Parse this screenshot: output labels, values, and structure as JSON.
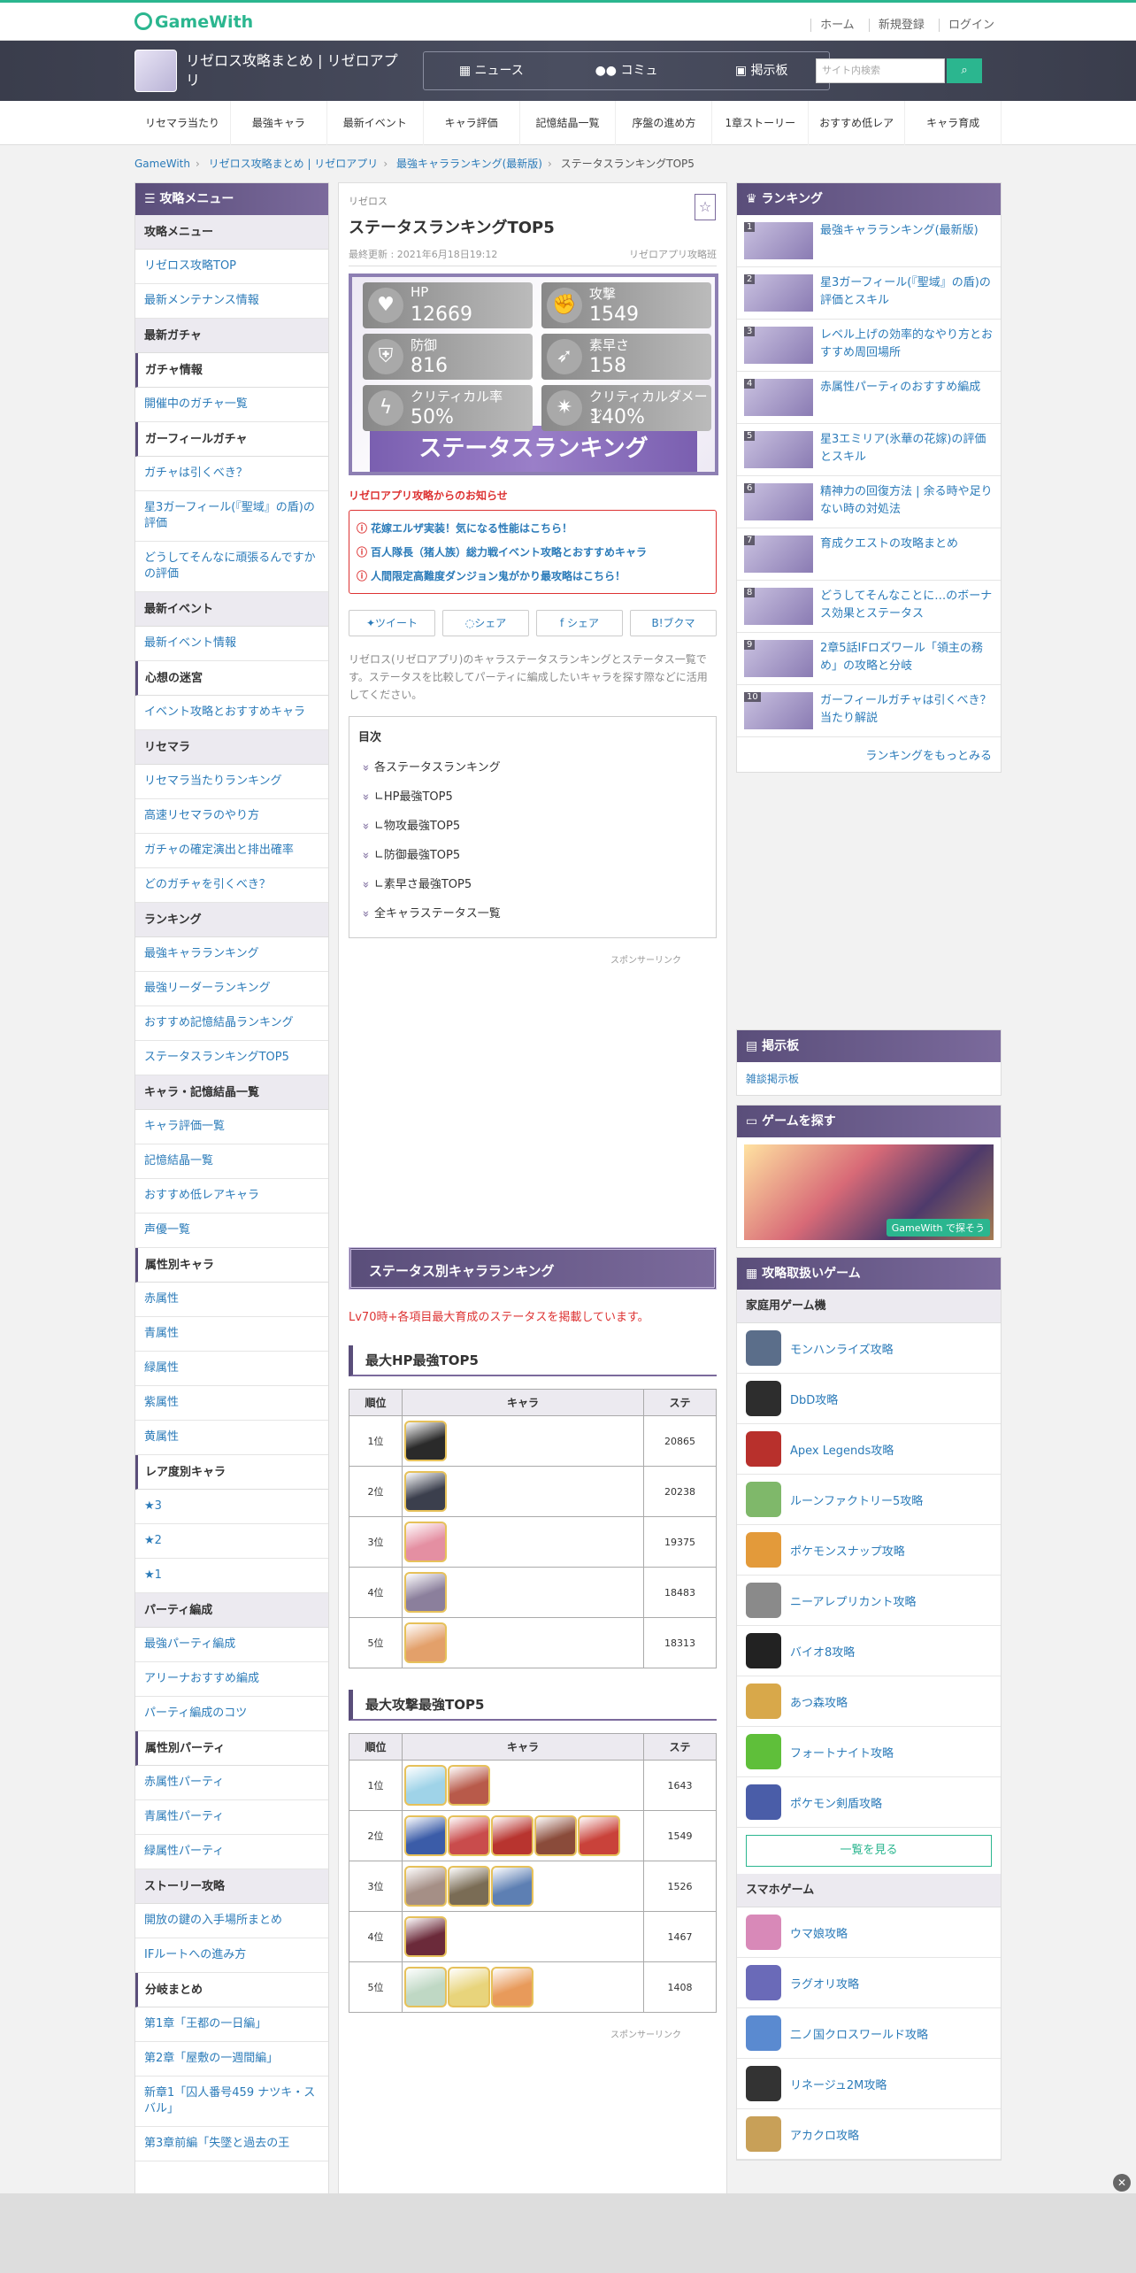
{
  "header": {
    "logo": "GameWith",
    "links": [
      "ホーム",
      "新規登録",
      "ログイン"
    ]
  },
  "gamebar": {
    "title": "リゼロス攻略まとめ | リゼロアプリ",
    "nav": [
      "ニュース",
      "コミュ",
      "掲示板"
    ],
    "search_placeholder": "サイト内検索"
  },
  "subnav": [
    "リセマラ当たり",
    "最強キャラ",
    "最新イベント",
    "キャラ評価",
    "記憶結晶一覧",
    "序盤の進め方",
    "1章ストーリー",
    "おすすめ低レア",
    "キャラ育成"
  ],
  "breadcrumb": [
    "GameWith",
    "リゼロス攻略まとめ | リゼロアプリ",
    "最強キャラランキング(最新版)",
    "ステータスランキングTOP5"
  ],
  "left_menu": {
    "title": "攻略メニュー",
    "entries": [
      {
        "t": "sec",
        "label": "攻略メニュー"
      },
      {
        "t": "item",
        "label": "リゼロス攻略TOP"
      },
      {
        "t": "item",
        "label": "最新メンテナンス情報"
      },
      {
        "t": "sec",
        "label": "最新ガチャ"
      },
      {
        "t": "sub",
        "label": "ガチャ情報"
      },
      {
        "t": "item",
        "label": "開催中のガチャ一覧"
      },
      {
        "t": "sub",
        "label": "ガーフィールガチャ"
      },
      {
        "t": "item",
        "label": "ガチャは引くべき？"
      },
      {
        "t": "item",
        "label": "星3ガーフィール(『聖域』の盾)の評価"
      },
      {
        "t": "item",
        "label": "どうしてそんなに頑張るんですかの評価"
      },
      {
        "t": "sec",
        "label": "最新イベント"
      },
      {
        "t": "item",
        "label": "最新イベント情報"
      },
      {
        "t": "sub",
        "label": "心想の迷宮"
      },
      {
        "t": "item",
        "label": "イベント攻略とおすすめキャラ"
      },
      {
        "t": "sec",
        "label": "リセマラ"
      },
      {
        "t": "item",
        "label": "リセマラ当たりランキング"
      },
      {
        "t": "item",
        "label": "高速リセマラのやり方"
      },
      {
        "t": "item",
        "label": "ガチャの確定演出と排出確率"
      },
      {
        "t": "item",
        "label": "どのガチャを引くべき？"
      },
      {
        "t": "sec",
        "label": "ランキング"
      },
      {
        "t": "item",
        "label": "最強キャラランキング"
      },
      {
        "t": "item",
        "label": "最強リーダーランキング"
      },
      {
        "t": "item",
        "label": "おすすめ記憶結晶ランキング"
      },
      {
        "t": "item",
        "label": "ステータスランキングTOP5"
      },
      {
        "t": "sec",
        "label": "キャラ・記憶結晶一覧"
      },
      {
        "t": "item",
        "label": "キャラ評価一覧"
      },
      {
        "t": "item",
        "label": "記憶結晶一覧"
      },
      {
        "t": "item",
        "label": "おすすめ低レアキャラ"
      },
      {
        "t": "item",
        "label": "声優一覧"
      },
      {
        "t": "sub",
        "label": "属性別キャラ"
      },
      {
        "t": "item",
        "label": "赤属性"
      },
      {
        "t": "item",
        "label": "青属性"
      },
      {
        "t": "item",
        "label": "緑属性"
      },
      {
        "t": "item",
        "label": "紫属性"
      },
      {
        "t": "item",
        "label": "黄属性"
      },
      {
        "t": "sub",
        "label": "レア度別キャラ"
      },
      {
        "t": "item",
        "label": "★3"
      },
      {
        "t": "item",
        "label": "★2"
      },
      {
        "t": "item",
        "label": "★1"
      },
      {
        "t": "sec",
        "label": "パーティ編成"
      },
      {
        "t": "item",
        "label": "最強パーティ編成"
      },
      {
        "t": "item",
        "label": "アリーナおすすめ編成"
      },
      {
        "t": "item",
        "label": "パーティ編成のコツ"
      },
      {
        "t": "sub",
        "label": "属性別パーティ"
      },
      {
        "t": "item",
        "label": "赤属性パーティ"
      },
      {
        "t": "item",
        "label": "青属性パーティ"
      },
      {
        "t": "item",
        "label": "緑属性パーティ"
      },
      {
        "t": "sec",
        "label": "ストーリー攻略"
      },
      {
        "t": "item",
        "label": "開放の鍵の入手場所まとめ"
      },
      {
        "t": "item",
        "label": "IFルートへの進み方"
      },
      {
        "t": "sub",
        "label": "分岐まとめ"
      },
      {
        "t": "item",
        "label": "第1章「王都の一日編」"
      },
      {
        "t": "item",
        "label": "第2章「屋敷の一週間編」"
      },
      {
        "t": "item",
        "label": "新章1「囚人番号459 ナツキ・スバル」"
      },
      {
        "t": "item",
        "label": "第3章前編「失墜と過去の王"
      }
    ]
  },
  "article": {
    "game_label": "リゼロス",
    "title": "ステータスランキングTOP5",
    "updated": "最終更新 : 2021年6月18日19:12",
    "author": "リゼロアプリ攻略班",
    "banner": {
      "stats": [
        {
          "name": "HP",
          "value": "12669",
          "icon": "♥"
        },
        {
          "name": "攻撃",
          "value": "1549",
          "icon": "✊"
        },
        {
          "name": "防御",
          "value": "816",
          "icon": "⛨"
        },
        {
          "name": "素早さ",
          "value": "158",
          "icon": "➶"
        },
        {
          "name": "クリティカル率",
          "value": "50%",
          "icon": "ϟ"
        },
        {
          "name": "クリティカルダメージ",
          "value": "140%",
          "icon": "✷"
        }
      ],
      "band": "ステータスランキング"
    },
    "notice_label": "リゼロアプリ攻略からのお知らせ",
    "notices": [
      "花嫁エルザ実装！気になる性能はこちら！",
      "百人隊長（猪人族）総力戦イベント攻略とおすすめキャラ",
      "人間限定高難度ダンジョン鬼がかり最攻略はこちら！"
    ],
    "share": [
      "ツイート",
      "シェア",
      "シェア",
      "ブクマ"
    ],
    "intro": "リゼロス(リゼロアプリ)のキャラステータスランキングとステータス一覧です。ステータスを比較してパーティに編成したいキャラを探す際などに活用してください。",
    "toc_title": "目次",
    "toc": [
      "各ステータスランキング",
      "∟HP最強TOP5",
      "∟物攻最強TOP5",
      "∟防御最強TOP5",
      "∟素早さ最強TOP5",
      "全キャラステータス一覧"
    ],
    "sponsor": "スポンサーリンク",
    "section_title": "ステータス別キャラランキング",
    "red_note": "Lv70時+各項目最大育成のステータスを掲載しています。",
    "table_headers": [
      "順位",
      "キャラ",
      "ステ"
    ],
    "hp_title": "最大HP最強TOP5",
    "hp_rows": [
      {
        "rank": "1位",
        "value": "20865",
        "chars": [
          "#2a2a2a"
        ]
      },
      {
        "rank": "2位",
        "value": "20238",
        "chars": [
          "#3b3f4d"
        ]
      },
      {
        "rank": "3位",
        "value": "19375",
        "chars": [
          "#e48fa2"
        ]
      },
      {
        "rank": "4位",
        "value": "18483",
        "chars": [
          "#8b7f9c"
        ]
      },
      {
        "rank": "5位",
        "value": "18313",
        "chars": [
          "#e3a06a"
        ]
      }
    ],
    "atk_title": "最大攻撃最強TOP5",
    "atk_rows": [
      {
        "rank": "1位",
        "value": "1643",
        "chars": [
          "#9fd3e8",
          "#b85a4a"
        ]
      },
      {
        "rank": "2位",
        "value": "1549",
        "chars": [
          "#3b5ca8",
          "#c94c4c",
          "#b8342f",
          "#8a4b3a",
          "#c9423a"
        ]
      },
      {
        "rank": "3位",
        "value": "1526",
        "chars": [
          "#a58f86",
          "#7a6c55",
          "#5d7fb3"
        ]
      },
      {
        "rank": "4位",
        "value": "1467",
        "chars": [
          "#6b2a3a"
        ]
      },
      {
        "rank": "5位",
        "value": "1408",
        "chars": [
          "#bfd8c4",
          "#e8d47b",
          "#e89a5a"
        ]
      }
    ]
  },
  "right": {
    "ranking_title": "ランキング",
    "ranking": [
      {
        "n": "1",
        "label": "最強キャラランキング(最新版)"
      },
      {
        "n": "2",
        "label": "星3ガーフィール(『聖域』の盾)の評価とスキル"
      },
      {
        "n": "3",
        "label": "レベル上げの効率的なやり方とおすすめ周回場所"
      },
      {
        "n": "4",
        "label": "赤属性パーティのおすすめ編成"
      },
      {
        "n": "5",
        "label": "星3エミリア(氷華の花嫁)の評価とスキル"
      },
      {
        "n": "6",
        "label": "精神力の回復方法 | 余る時や足りない時の対処法"
      },
      {
        "n": "7",
        "label": "育成クエストの攻略まとめ"
      },
      {
        "n": "8",
        "label": "どうしてそんなことに…のボーナス効果とステータス"
      },
      {
        "n": "9",
        "label": "2章5話IFロズワール「領主の務め」の攻略と分岐"
      },
      {
        "n": "10",
        "label": "ガーフィールガチャは引くべき？当たり解説"
      }
    ],
    "ranking_more": "ランキングをもっとみる",
    "board_title": "掲示板",
    "board_link": "雑談掲示板",
    "find_title": "ゲームを探す",
    "find_badge": "GameWith で探そう",
    "games_title": "攻略取扱いゲーム",
    "console_title": "家庭用ゲーム機",
    "console": [
      {
        "name": "モンハンライズ攻略",
        "color": "#5b6e8a"
      },
      {
        "name": "DbD攻略",
        "color": "#2d2d2d"
      },
      {
        "name": "Apex Legends攻略",
        "color": "#b8302c"
      },
      {
        "name": "ルーンファクトリー5攻略",
        "color": "#7fb86a"
      },
      {
        "name": "ポケモンスナップ攻略",
        "color": "#e39a3a"
      },
      {
        "name": "ニーアレプリカント攻略",
        "color": "#8a8a8a"
      },
      {
        "name": "バイオ8攻略",
        "color": "#222222"
      },
      {
        "name": "あつ森攻略",
        "color": "#d8a84a"
      },
      {
        "name": "フォートナイト攻略",
        "color": "#5fbf3a"
      },
      {
        "name": "ポケモン剣盾攻略",
        "color": "#4a5da8"
      }
    ],
    "see_all": "一覧を見る",
    "mobile_title": "スマホゲーム",
    "mobile": [
      {
        "name": "ウマ娘攻略",
        "color": "#d889b8"
      },
      {
        "name": "ラグオリ攻略",
        "color": "#6a6ab8"
      },
      {
        "name": "二ノ国クロスワールド攻略",
        "color": "#5a8ad0"
      },
      {
        "name": "リネージュ2M攻略",
        "color": "#333333"
      },
      {
        "name": "アカクロ攻略",
        "color": "#c8a058"
      }
    ]
  }
}
